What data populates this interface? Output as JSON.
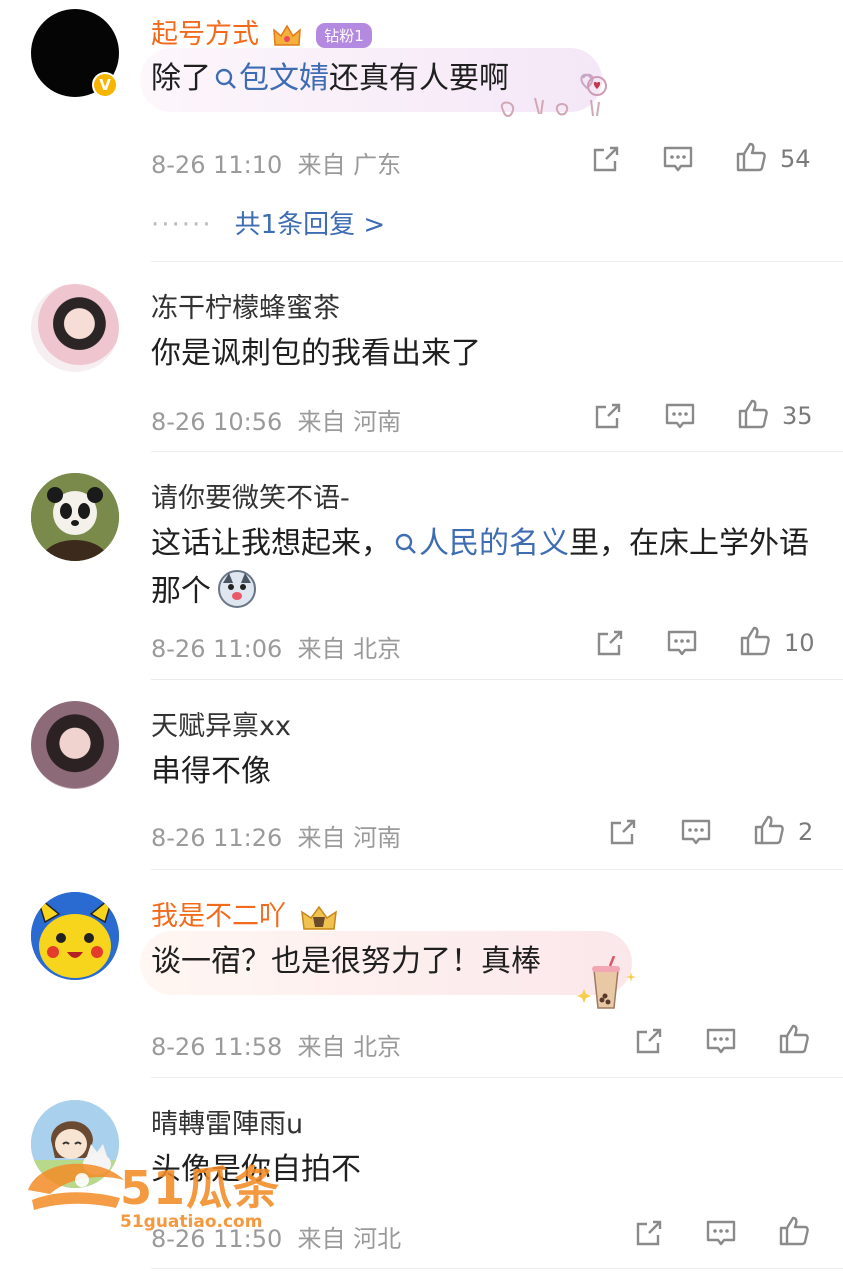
{
  "comments": [
    {
      "username": "起号方式",
      "fan_badge": "钻粉1",
      "text_before": "除了",
      "link": "包文婧",
      "text_after": "还真有人要啊",
      "time": "8-26 11:10",
      "from_label": "来自",
      "location": "广东",
      "likes": "54",
      "replies_text": "共1条回复 >",
      "verified_mark": "V"
    },
    {
      "username": "冻干柠檬蜂蜜茶",
      "text": "你是讽刺包的我看出来了",
      "time": "8-26 10:56",
      "from_label": "来自",
      "location": "河南",
      "likes": "35"
    },
    {
      "username": "请你要微笑不语-",
      "text_before": "这话让我想起来，",
      "link": "人民的名义",
      "text_after": "里，在床上学外语那个",
      "time": "8-26 11:06",
      "from_label": "来自",
      "location": "北京",
      "likes": "10"
    },
    {
      "username": "天赋异禀xx",
      "text": "串得不像",
      "time": "8-26 11:26",
      "from_label": "来自",
      "location": "河南",
      "likes": "2"
    },
    {
      "username": "我是不二吖",
      "text": "谈一宿？也是很努力了！真棒",
      "time": "8-26 11:58",
      "from_label": "来自",
      "location": "北京",
      "likes": ""
    },
    {
      "username": "晴轉雷陣雨u",
      "text": "头像是你自拍不",
      "time": "8-26 11:50",
      "from_label": "来自",
      "location": "河北",
      "likes": ""
    }
  ],
  "watermark": {
    "brand": "51瓜条",
    "url": "51guatiao.com"
  },
  "colors": {
    "vip_name": "#f26b1d",
    "link": "#3f6db3",
    "meta": "#9a9a9a"
  }
}
